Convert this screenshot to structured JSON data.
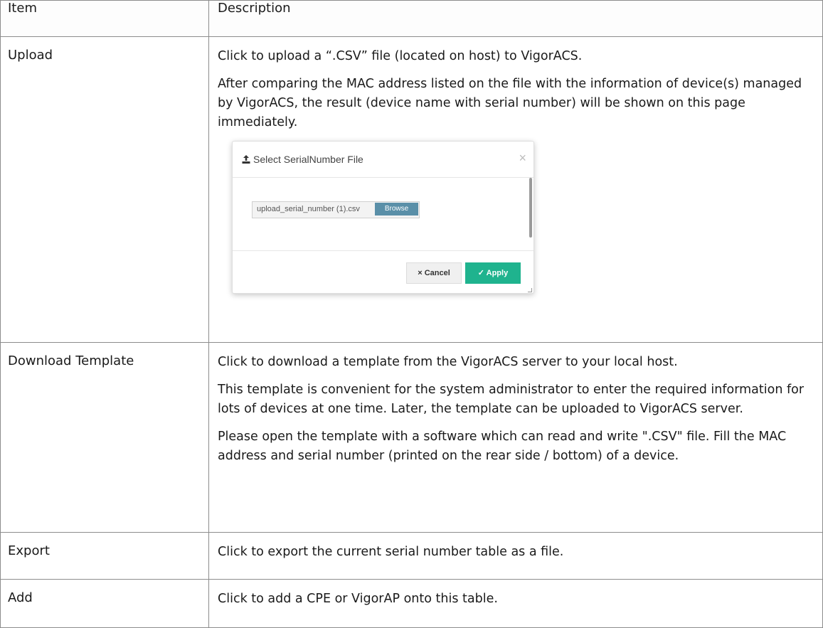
{
  "header": {
    "item": "Item",
    "description": "Description"
  },
  "rows": [
    {
      "item": "Upload",
      "desc": [
        "Click to upload a “.CSV” file (located on host) to VigorACS.",
        "After comparing the MAC address listed on the file with the information of device(s) managed by VigorACS, the result (device name with serial number) will be shown on this page immediately."
      ]
    },
    {
      "item": "Download Template",
      "desc": [
        "Click to download a template from the VigorACS server to your local host.",
        "This template is convenient for the system administrator to enter the required information for lots of devices at one time. Later, the template can be uploaded to VigorACS server.",
        "Please open the template with a software which can read and write \".CSV\" file. Fill the MAC address and serial number (printed on the rear side / bottom) of a device."
      ]
    },
    {
      "item": "Export",
      "desc": [
        "Click to export the current serial number table as a file."
      ]
    },
    {
      "item": "Add",
      "desc": [
        "Click to add a CPE or VigorAP onto this table."
      ]
    }
  ],
  "dialog": {
    "title": "Select SerialNumber File",
    "close": "×",
    "file_name": "upload_serial_number (1).csv",
    "browse": "Browse",
    "cancel": "× Cancel",
    "apply": "✓ Apply",
    "icons": {
      "title": "upload-icon",
      "close": "close-icon"
    },
    "colors": {
      "browse": "#5a8fa8",
      "apply": "#1fb38e"
    }
  }
}
